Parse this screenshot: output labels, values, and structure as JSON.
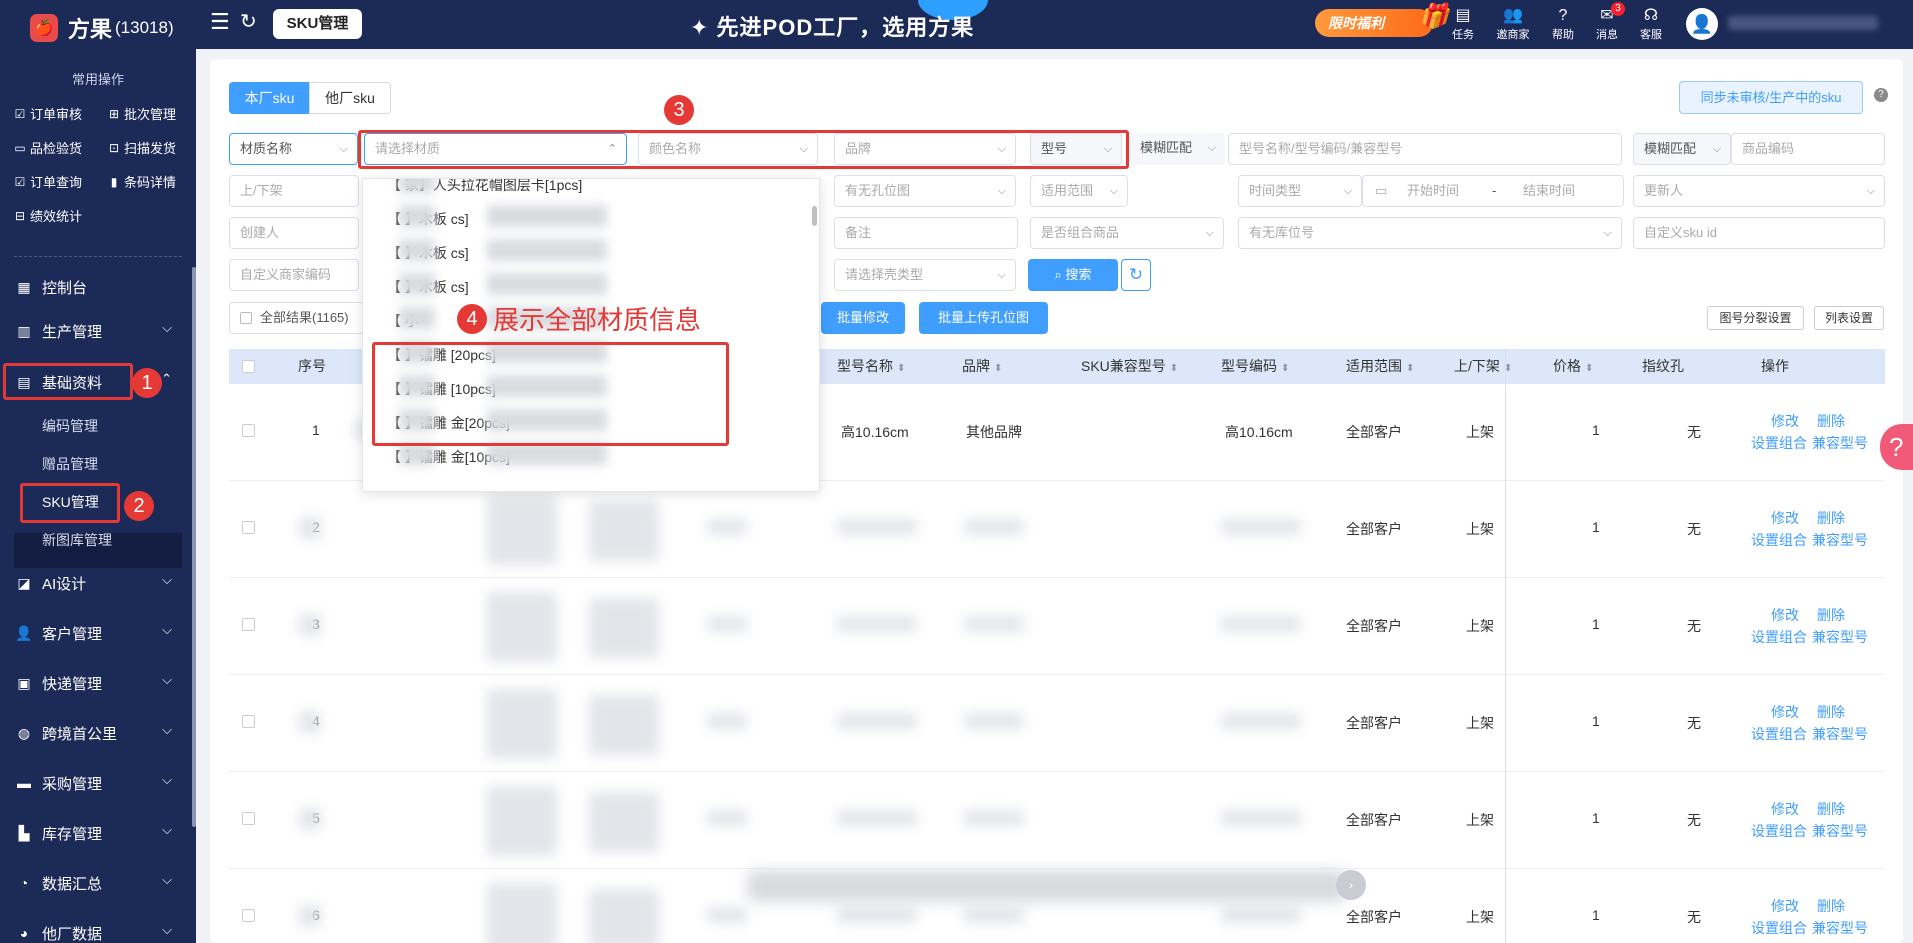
{
  "topbar": {
    "brand": "方果",
    "brand_id": "(13018)",
    "page_chip": "SKU管理",
    "slogan": "✦ 先进POD工厂，选用方果",
    "promo": "限时福利",
    "icons": [
      {
        "label": "任务",
        "icon": "task-icon"
      },
      {
        "label": "邀商家",
        "icon": "invite-icon"
      },
      {
        "label": "帮助",
        "icon": "help-icon"
      },
      {
        "label": "消息",
        "icon": "message-icon"
      },
      {
        "label": "客服",
        "icon": "headset-icon"
      }
    ],
    "message_count": "3"
  },
  "sidebar": {
    "common_title": "常用操作",
    "quick": [
      "订单审核",
      "批次管理",
      "品检验货",
      "扫描发货",
      "订单查询",
      "条码详情",
      "绩效统计"
    ],
    "menu": [
      "控制台",
      "生产管理",
      "基础资料",
      "AI设计",
      "客户管理",
      "快递管理",
      "跨境首公里",
      "采购管理",
      "库存管理",
      "数据汇总",
      "他厂数据"
    ],
    "sub": [
      "编码管理",
      "赠品管理",
      "SKU管理",
      "新图库管理"
    ]
  },
  "annotations": [
    "1",
    "2",
    "3",
    "4",
    "展示全部材质信息"
  ],
  "tabs": [
    "本厂sku",
    "他厂sku"
  ],
  "sync_button": "同步未审核/生产中的sku",
  "filters": {
    "material_name": "材质名称",
    "material_placeholder": "请选择材质",
    "color_name": "颜色名称",
    "brand": "品牌",
    "model": "型号",
    "fuzzy1": "模糊匹配",
    "model_search": "型号名称/型号编码/兼容型号",
    "fuzzy2": "模糊匹配",
    "goods_code": "商品编码",
    "shelf": "上/下架",
    "hole": "有无孔位图",
    "scope": "适用范围",
    "time_type": "时间类型",
    "start_time": "开始时间",
    "dash": "-",
    "end_time": "结束时间",
    "updater": "更新人",
    "creator": "创建人",
    "remark": "备注",
    "combo": "是否组合商品",
    "stock_loc": "有无库位号",
    "custom_sku": "自定义sku id",
    "custom_merchant": "自定义商家编码",
    "shell_type": "请选择壳类型",
    "search": "搜索"
  },
  "actions": {
    "all_results": "全部结果(1165)",
    "batch_edit": "批量修改",
    "batch_upload": "批量上传孔位图",
    "split_settings": "图号分裂设置",
    "list_settings": "列表设置"
  },
  "table": {
    "headers": [
      "序号",
      "型号名称",
      "品牌",
      "SKU兼容型号",
      "型号编码",
      "适用范围",
      "上/下架",
      "价格",
      "指纹孔",
      "操作"
    ],
    "rows": [
      {
        "no": "1",
        "model": "高10.16cm",
        "brand": "其他品牌",
        "code": "高10.16cm",
        "scope": "全部客户",
        "shelf": "上架",
        "price": "1",
        "hole": "无"
      },
      {
        "no": "2",
        "model": "",
        "brand": "",
        "code": "",
        "scope": "全部客户",
        "shelf": "上架",
        "price": "1",
        "hole": "无"
      },
      {
        "no": "3",
        "model": "",
        "brand": "",
        "code": "",
        "scope": "全部客户",
        "shelf": "上架",
        "price": "1",
        "hole": "无"
      },
      {
        "no": "4",
        "model": "",
        "brand": "",
        "code": "",
        "scope": "全部客户",
        "shelf": "上架",
        "price": "1",
        "hole": "无"
      },
      {
        "no": "5",
        "model": "",
        "brand": "",
        "code": "",
        "scope": "全部客户",
        "shelf": "上架",
        "price": "1",
        "hole": "无"
      },
      {
        "no": "6",
        "model": "",
        "brand": "",
        "code": "",
        "scope": "全部客户",
        "shelf": "上架",
        "price": "1",
        "hole": "无"
      }
    ],
    "op_edit": "修改",
    "op_delete": "删除",
    "op_combo": "设置组合",
    "op_compat": "兼容型号"
  },
  "dropdown": {
    "items": [
      "【 家】人头拉花帽图层卡[1pcs]",
      "【 】木板 cs]",
      "【 】木板 cs]",
      "【 】木板 cs]",
      "【 小",
      "【 】镭雕 [20pcs]",
      "【 】镭雕 [10pcs]",
      "【 】镭雕 金[20pcs]",
      "【 】镭雕 金[10pcs]"
    ]
  },
  "colors": {
    "primary": "#409eff",
    "sidebar": "#1c2a57",
    "annotation": "#e53935"
  }
}
